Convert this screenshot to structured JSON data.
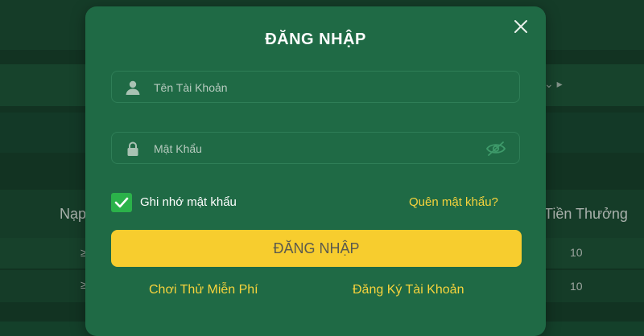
{
  "background": {
    "left_header": "Nạp",
    "right_header": "Tiền Thưởng",
    "rows": [
      {
        "left": "≥",
        "right": "10"
      },
      {
        "left": "≥",
        "right": "10"
      }
    ],
    "chevron": "⌄ ▸"
  },
  "login_modal": {
    "title": "ĐĂNG NHẬP",
    "close_icon": "close-icon",
    "username": {
      "placeholder": "Tên Tài Khoản",
      "value": "",
      "icon": "user-icon"
    },
    "password": {
      "placeholder": "Mật Khẩu",
      "value": "",
      "icon": "lock-icon",
      "toggle_icon": "eye-off-icon"
    },
    "remember": {
      "label": "Ghi nhớ mật khẩu",
      "checked": true
    },
    "forgot_label": "Quên mật khẩu?",
    "submit_label": "ĐĂNG NHẬP",
    "trial_label": "Chơi Thử Miễn Phí",
    "register_label": "Đăng Ký Tài Khoản"
  },
  "colors": {
    "modal_bg": "#1f6a45",
    "accent_yellow": "#f7cd2e",
    "link_yellow": "#f7d33c",
    "checkbox_green": "#2bb24a"
  }
}
